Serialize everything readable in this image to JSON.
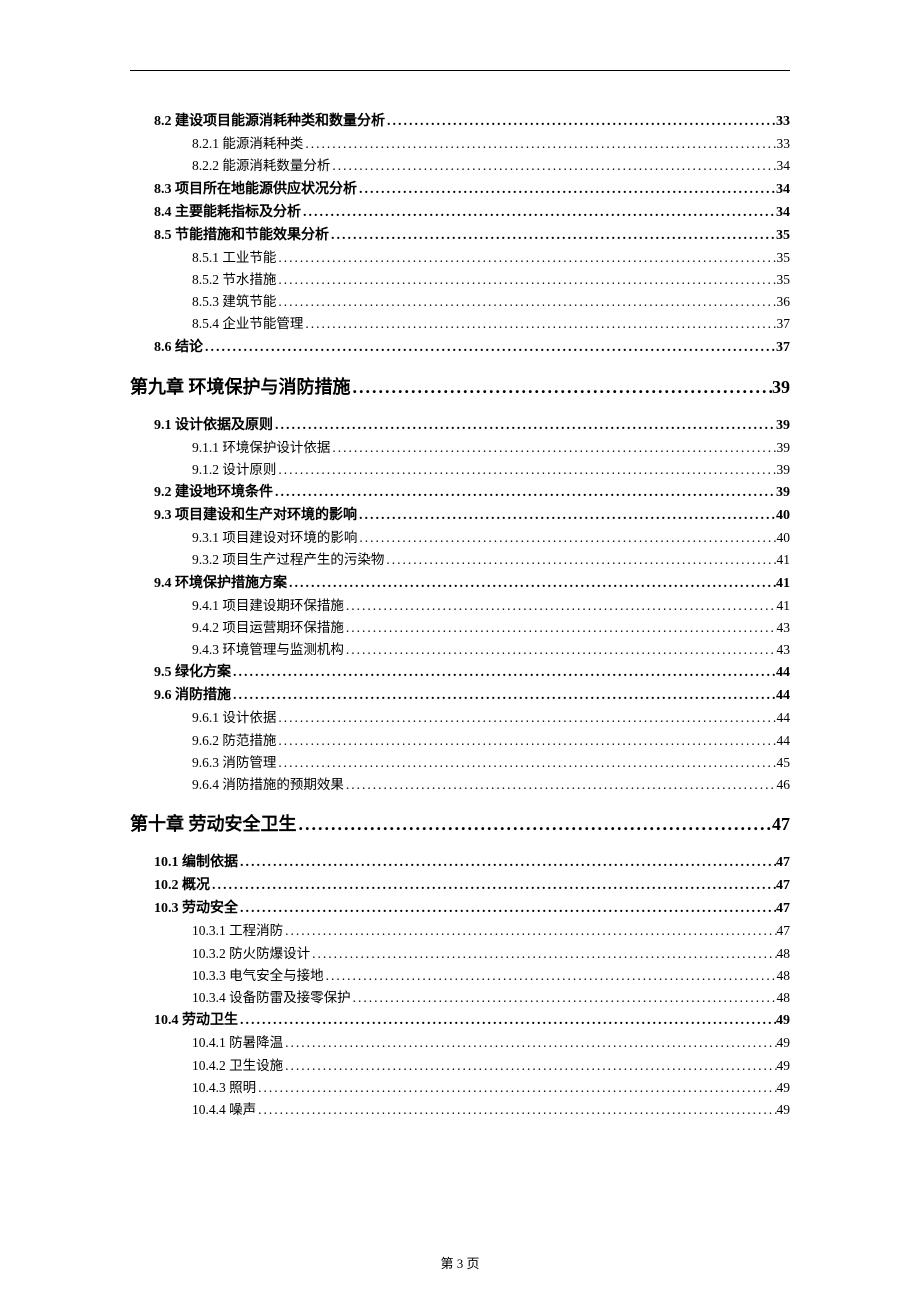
{
  "footer": "第 3 页",
  "entries": [
    {
      "level": 2,
      "num": "8.2",
      "title": "建设项目能源消耗种类和数量分析",
      "page": "33"
    },
    {
      "level": 3,
      "num": "8.2.1",
      "title": "能源消耗种类",
      "page": "33"
    },
    {
      "level": 3,
      "num": "8.2.2",
      "title": "能源消耗数量分析",
      "page": "34"
    },
    {
      "level": 2,
      "num": "8.3",
      "title": "项目所在地能源供应状况分析",
      "page": "34"
    },
    {
      "level": 2,
      "num": "8.4",
      "title": "主要能耗指标及分析",
      "page": "34"
    },
    {
      "level": 2,
      "num": "8.5",
      "title": "节能措施和节能效果分析",
      "page": "35"
    },
    {
      "level": 3,
      "num": "8.5.1",
      "title": "工业节能",
      "page": "35"
    },
    {
      "level": 3,
      "num": "8.5.2",
      "title": "节水措施",
      "page": "35"
    },
    {
      "level": 3,
      "num": "8.5.3",
      "title": "建筑节能",
      "page": "36"
    },
    {
      "level": 3,
      "num": "8.5.4",
      "title": "企业节能管理",
      "page": "37"
    },
    {
      "level": 2,
      "num": "8.6",
      "title": "结论",
      "page": "37"
    },
    {
      "level": 1,
      "num": "第九章",
      "title": "环境保护与消防措施",
      "page": "39"
    },
    {
      "level": 2,
      "num": "9.1",
      "title": "设计依据及原则",
      "page": "39"
    },
    {
      "level": 3,
      "num": "9.1.1",
      "title": "环境保护设计依据",
      "page": "39"
    },
    {
      "level": 3,
      "num": "9.1.2",
      "title": "设计原则",
      "page": "39"
    },
    {
      "level": 2,
      "num": "9.2",
      "title": "建设地环境条件",
      "page": "39"
    },
    {
      "level": 2,
      "num": "9.3",
      "title": "项目建设和生产对环境的影响",
      "page": "40"
    },
    {
      "level": 3,
      "num": "9.3.1",
      "title": "项目建设对环境的影响",
      "page": "40"
    },
    {
      "level": 3,
      "num": "9.3.2",
      "title": "项目生产过程产生的污染物",
      "page": "41"
    },
    {
      "level": 2,
      "num": "9.4",
      "title": "环境保护措施方案",
      "page": "41"
    },
    {
      "level": 3,
      "num": "9.4.1",
      "title": "项目建设期环保措施",
      "page": "41"
    },
    {
      "level": 3,
      "num": "9.4.2",
      "title": "项目运营期环保措施",
      "page": "43"
    },
    {
      "level": 3,
      "num": "9.4.3",
      "title": "环境管理与监测机构",
      "page": "43"
    },
    {
      "level": 2,
      "num": "9.5",
      "title": "绿化方案",
      "page": "44"
    },
    {
      "level": 2,
      "num": "9.6",
      "title": "消防措施",
      "page": "44"
    },
    {
      "level": 3,
      "num": "9.6.1",
      "title": "设计依据",
      "page": "44"
    },
    {
      "level": 3,
      "num": "9.6.2",
      "title": "防范措施",
      "page": "44"
    },
    {
      "level": 3,
      "num": "9.6.3",
      "title": "消防管理",
      "page": "45"
    },
    {
      "level": 3,
      "num": "9.6.4",
      "title": "消防措施的预期效果",
      "page": "46"
    },
    {
      "level": 1,
      "num": "第十章",
      "title": "劳动安全卫生",
      "page": "47"
    },
    {
      "level": 2,
      "num": "10.1",
      "title": "编制依据",
      "page": "47"
    },
    {
      "level": 2,
      "num": "10.2",
      "title": "概况",
      "page": "47"
    },
    {
      "level": 2,
      "num": "10.3",
      "title": "劳动安全",
      "page": "47"
    },
    {
      "level": 3,
      "num": "10.3.1",
      "title": "工程消防",
      "page": "47"
    },
    {
      "level": 3,
      "num": "10.3.2",
      "title": "防火防爆设计",
      "page": "48"
    },
    {
      "level": 3,
      "num": "10.3.3",
      "title": "电气安全与接地",
      "page": "48"
    },
    {
      "level": 3,
      "num": "10.3.4",
      "title": "设备防雷及接零保护",
      "page": "48"
    },
    {
      "level": 2,
      "num": "10.4",
      "title": "劳动卫生",
      "page": "49"
    },
    {
      "level": 3,
      "num": "10.4.1",
      "title": "防暑降温",
      "page": "49"
    },
    {
      "level": 3,
      "num": "10.4.2",
      "title": "卫生设施",
      "page": "49"
    },
    {
      "level": 3,
      "num": "10.4.3",
      "title": "照明",
      "page": "49"
    },
    {
      "level": 3,
      "num": "10.4.4",
      "title": "噪声",
      "page": "49"
    }
  ]
}
